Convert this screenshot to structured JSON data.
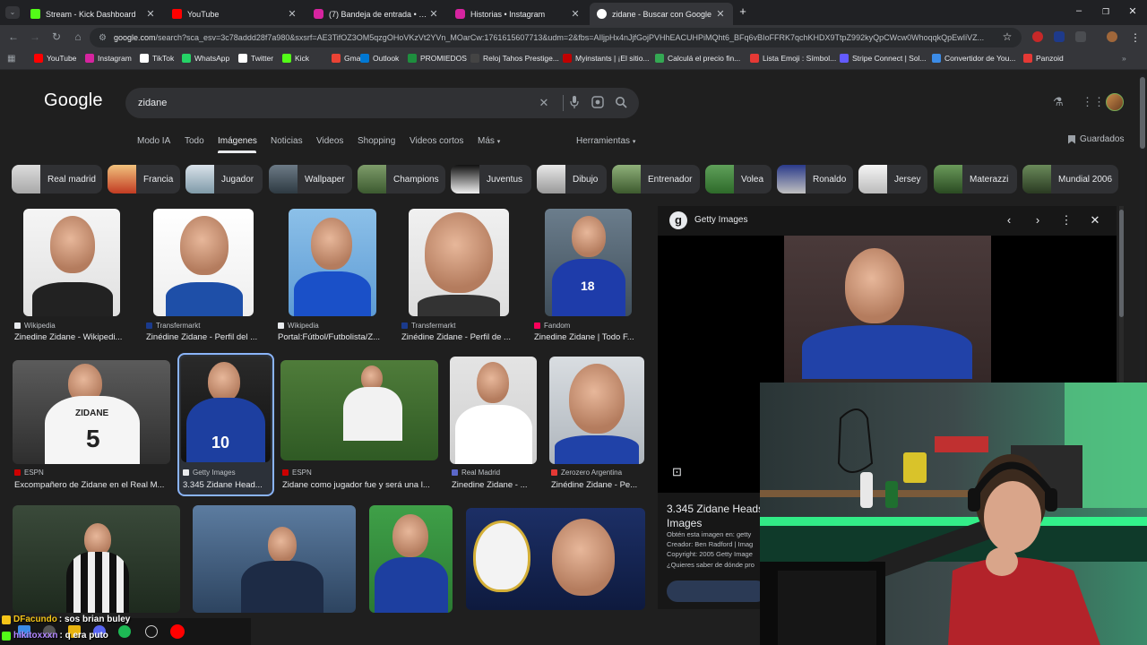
{
  "browser": {
    "tabs": [
      {
        "title": "Stream - Kick Dashboard",
        "favicon_color": "#53fc18",
        "active": false
      },
      {
        "title": "YouTube",
        "favicon_color": "#ff0000",
        "active": false
      },
      {
        "title": "(7) Bandeja de entrada • Chats",
        "favicon_color": "#d6249f",
        "active": false
      },
      {
        "title": "Historias • Instagram",
        "favicon_color": "#d6249f",
        "active": false
      },
      {
        "title": "zidane - Buscar con Google",
        "favicon_color": "#ffffff",
        "active": true
      }
    ],
    "new_tab": "+",
    "window_controls": {
      "minimize": "–",
      "maximize": "❐",
      "close": "✕"
    },
    "url_site": "google.com",
    "url_rest": "/search?sca_esv=3c78addd28f7a980&sxsrf=AE3TifOZ3OM5qzgOHoVKzVt2YVn_MOarCw:1761615607713&udm=2&fbs=AIljpHx4nJjfGojPVHhEACUHPiMQht6_BFq6vBIoFFRK7qchKHDX9TtpZ992kyQpCWcw0WhoqqkQpEwIiVZ...",
    "bookmarks": [
      {
        "label": "YouTube",
        "color": "#ff0000"
      },
      {
        "label": "Instagram",
        "color": "#d6249f"
      },
      {
        "label": "TikTok",
        "color": "#ffffff"
      },
      {
        "label": "WhatsApp",
        "color": "#25d366"
      },
      {
        "label": "Twitter",
        "color": "#ffffff"
      },
      {
        "label": "Kick",
        "color": "#53fc18"
      },
      {
        "label": "Gmail",
        "color": "#ea4335"
      },
      {
        "label": "Outlook",
        "color": "#0078d4"
      },
      {
        "label": "PROMIEDOS",
        "color": "#1e8e3e"
      },
      {
        "label": "Reloj Tahos Prestige...",
        "color": "#444444"
      },
      {
        "label": "Myinstants | ¡El sitio...",
        "color": "#c00000"
      },
      {
        "label": "Calculá el precio fin...",
        "color": "#34a853"
      },
      {
        "label": "Lista Emoji : Símbol...",
        "color": "#e53935"
      },
      {
        "label": "Stripe Connect | Sol...",
        "color": "#635bff"
      },
      {
        "label": "Convertidor de You...",
        "color": "#3c8ce7"
      },
      {
        "label": "Panzoid",
        "color": "#e53935"
      }
    ]
  },
  "google": {
    "logo": "Google",
    "query": "zidane",
    "nav_tabs": [
      "Modo IA",
      "Todo",
      "Imágenes",
      "Noticias",
      "Videos",
      "Shopping",
      "Videos cortos",
      "Más"
    ],
    "active_tab": "Imágenes",
    "tools": "Herramientas",
    "saved": "Guardados",
    "chips": [
      "Real madrid",
      "Francia",
      "Jugador",
      "Wallpaper",
      "Champions",
      "Juventus",
      "Dibujo",
      "Entrenador",
      "Volea",
      "Ronaldo",
      "Jersey",
      "Materazzi",
      "Mundial 2006"
    ],
    "results": [
      {
        "source": "Wikipedia",
        "caption": "Zinedine Zidane - Wikipedi...",
        "src_color": "#e8eaed"
      },
      {
        "source": "Transfermarkt",
        "caption": "Zinédine Zidane - Perfil del ...",
        "src_color": "#1a3a8c"
      },
      {
        "source": "Wikipedia",
        "caption": "Portal:Fútbol/Futbolista/Z...",
        "src_color": "#e8eaed"
      },
      {
        "source": "Transfermarkt",
        "caption": "Zinédine Zidane - Perfil de ...",
        "src_color": "#1a3a8c"
      },
      {
        "source": "Fandom",
        "caption": "Zinedine Zidane | Todo F...",
        "src_color": "#fa005a"
      },
      {
        "source": "ESPN",
        "caption": "Excompañero de Zidane en el Real M...",
        "src_color": "#cc0000"
      },
      {
        "source": "Getty Images",
        "caption": "3.345 Zidane Head...",
        "src_color": "#e8eaed"
      },
      {
        "source": "ESPN",
        "caption": "Zidane como jugador fue y será una l...",
        "src_color": "#cc0000"
      },
      {
        "source": "Real Madrid",
        "caption": "Zinedine Zidane - ...",
        "src_color": "#5b67c9"
      },
      {
        "source": "Zerozero Argentina",
        "caption": "Zinédine Zidane - Pe...",
        "src_color": "#e53935"
      }
    ],
    "jersey_text": {
      "zidane_back": "ZIDANE",
      "number_five": "5",
      "number_ten": "10",
      "number_eighteen": "18"
    }
  },
  "panel": {
    "site": "Getty Images",
    "title": "3.345 Zidane Heads Images",
    "meta": [
      "Obtén esta imagen en: getty",
      "Creador: Ben Radford | Imag",
      "Copyright: 2005 Getty Image",
      "¿Quieres saber de dónde pro"
    ]
  },
  "chat": [
    {
      "user": "DFacundo",
      "message": ": sos brian buley"
    },
    {
      "user": "hikitoxxxn",
      "message": ": q era puto"
    }
  ]
}
